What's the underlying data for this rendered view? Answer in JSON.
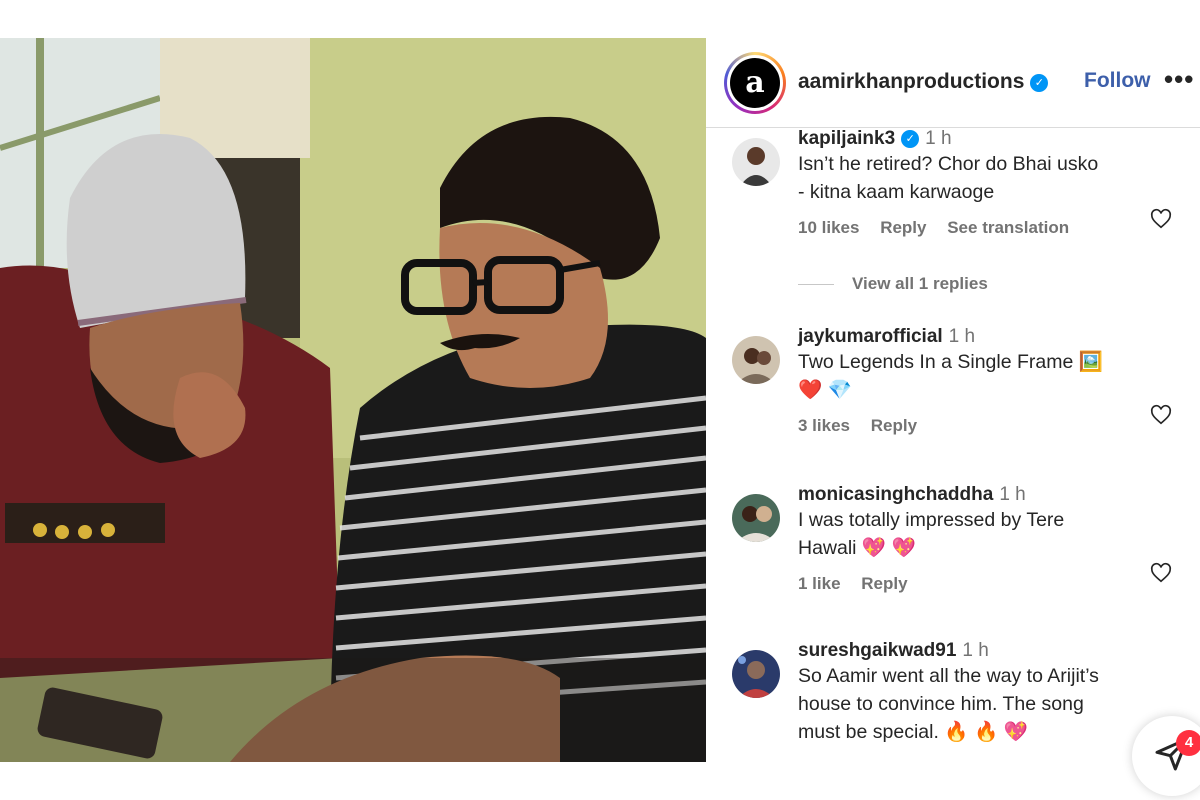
{
  "post": {
    "owner": "aamirkhanproductions",
    "owner_logo_letter": "a",
    "follow_label": "Follow",
    "more_label": "•••"
  },
  "comments": [
    {
      "user": "kapiljaink3",
      "verified": true,
      "time": "1 h",
      "text_line1": "Isn’t he retired? Chor do Bhai usko",
      "text_line2": "- kitna kaam karwaoge",
      "likes": "10 likes",
      "reply": "Reply",
      "translation": "See translation",
      "view_replies": "View all 1 replies"
    },
    {
      "user": "jaykumarofficial",
      "time": "1 h",
      "text_line1": "Two Legends In a Single Frame 🖼️",
      "text_line2": "❤️ 💎",
      "likes": "3 likes",
      "reply": "Reply"
    },
    {
      "user": "monicasinghchaddha",
      "time": "1 h",
      "text_line1": "I was totally impressed by Tere",
      "text_line2": "Hawali 💖 💖",
      "likes": "1 like",
      "reply": "Reply"
    },
    {
      "user": "sureshgaikwad91",
      "time": "1 h",
      "text_line1": "So Aamir went all the way to Arijit’s",
      "text_line2": "house to convince him. The song",
      "text_line3": "must be special. 🔥 🔥 💖"
    }
  ],
  "notification_count": "4",
  "colors": {
    "follow": "#3d5faa",
    "verified": "#0095f6",
    "badge": "#ff3040",
    "muted": "#737373"
  }
}
